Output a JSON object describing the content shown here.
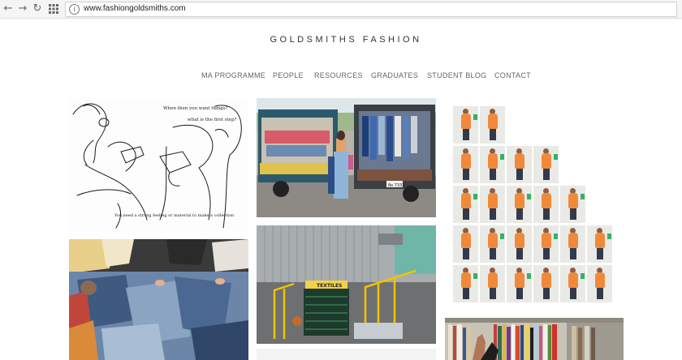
{
  "browser": {
    "url": "www.fashiongoldsmiths.com",
    "icons": [
      "back-arrow-icon",
      "forward-arrow-icon",
      "reload-icon",
      "apps-grid-icon",
      "page-info-icon"
    ]
  },
  "site": {
    "title": "GOLDSMITHS FASHION"
  },
  "nav": {
    "items": [
      {
        "label": "MA PROGRAMME"
      },
      {
        "label": "PEOPLE"
      },
      {
        "label": "RESOURCES"
      },
      {
        "label": "GRADUATES"
      },
      {
        "label": "STUDENT BLOG"
      },
      {
        "label": "CONTACT"
      }
    ]
  },
  "gallery": {
    "sketch_notes": {
      "note_1": "When then you want things?",
      "note_2": "what is the first step?",
      "note_3": "You need a strong feeling or material to make a collection"
    },
    "stairs_sign": "TEXTILES",
    "truck_plate": "8ผ 7331",
    "mosaic_rows": [
      2,
      4,
      5,
      6,
      6
    ]
  },
  "colors": {
    "accent_orange": "#f08a3a",
    "nav_text": "#666666",
    "title_text": "#333333"
  }
}
